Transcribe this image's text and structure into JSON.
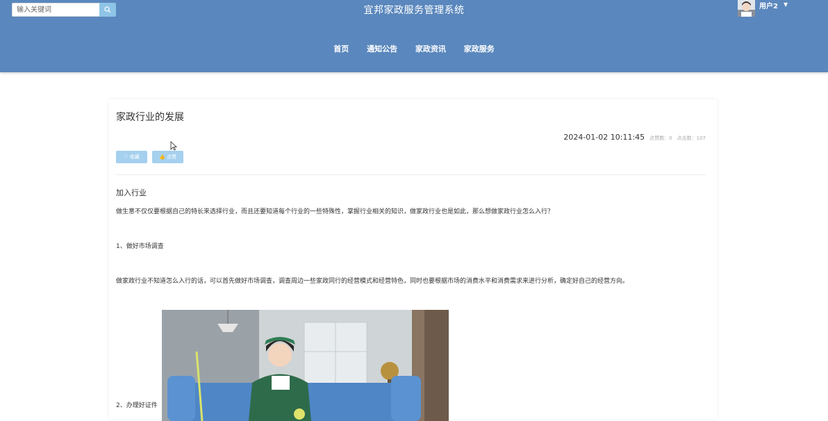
{
  "header": {
    "search_placeholder": "输入关键词",
    "site_title": "宜邦家政服务管理系统",
    "username": "用户2",
    "icons": {
      "search": "search-icon",
      "caret": "caret-down-icon",
      "avatar": "avatar-image"
    }
  },
  "nav": {
    "items": [
      "首页",
      "通知公告",
      "家政资讯",
      "家政服务"
    ]
  },
  "article": {
    "title": "家政行业的发展",
    "datetime": "2024-01-02 10:11:45",
    "likes_text": "点赞数：0",
    "clicks_text": "点击数：107",
    "fav_label": "♡ 收藏",
    "like_label": "👍 点赞",
    "section_title": "加入行业",
    "paragraphs": [
      "做生意不仅仅要根据自己的特长来选择行业，而且还要知道每个行业的一些特殊性，掌握行业相关的知识，做家政行业也是如此，那么想做家政行业怎么入行？",
      "1、做好市场调查",
      "做家政行业不知道怎么入行的话，可以首先做好市场调查，调查周边一些家政同行的经营模式和经营特色，同时也要根据市场的消费水平和消费需求来进行分析，确定好自己的经营方向。",
      "2、办理好证件"
    ]
  },
  "colors": {
    "header_bg": "#5a87bd",
    "button_bg": "#a5d0ee",
    "search_button": "#8ec4e6"
  }
}
